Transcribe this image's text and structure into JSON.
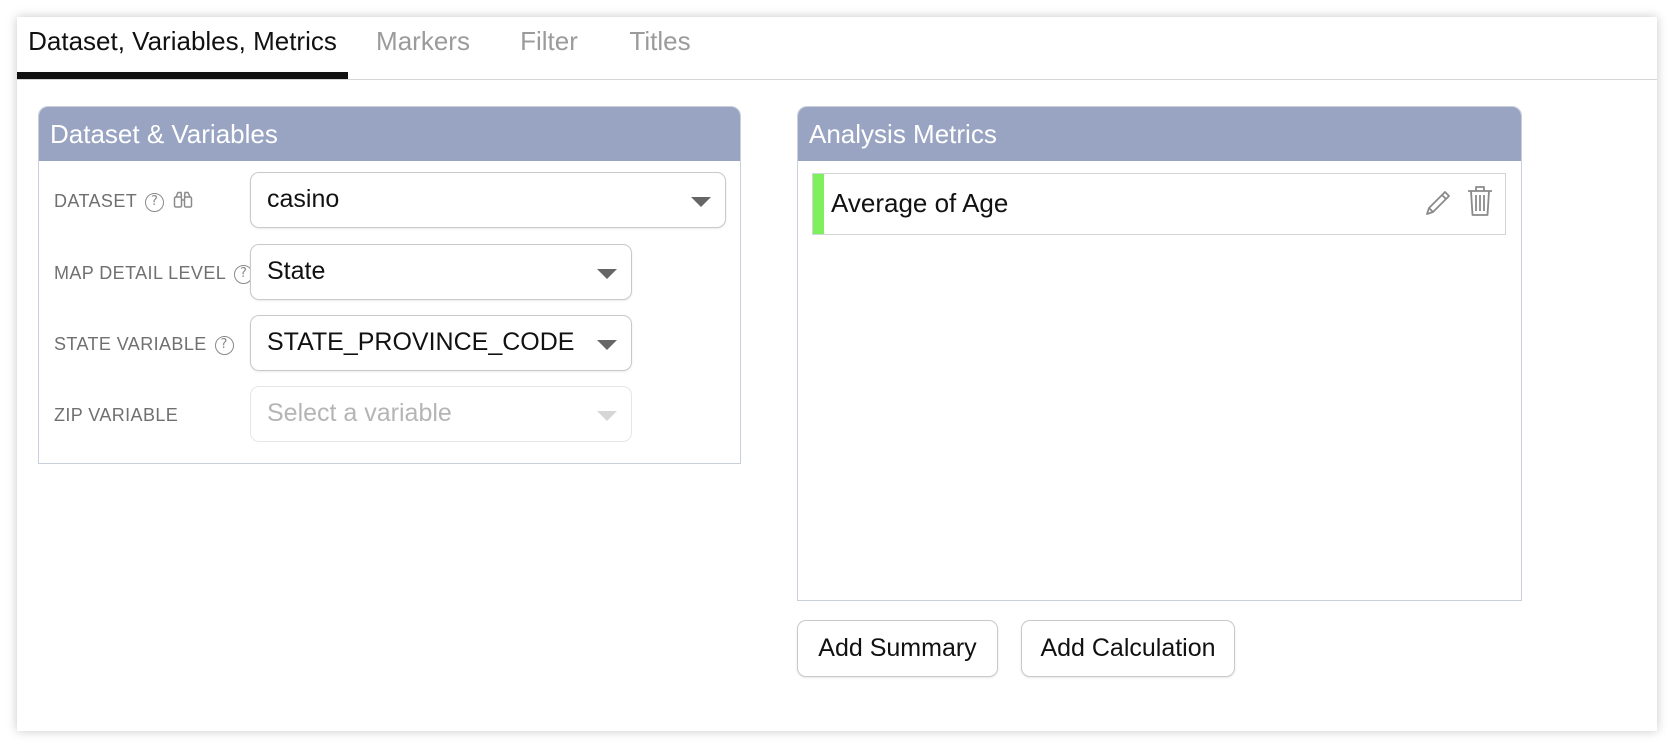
{
  "tabs": [
    {
      "label": "Dataset, Variables, Metrics",
      "active": true
    },
    {
      "label": "Markers",
      "active": false
    },
    {
      "label": "Filter",
      "active": false
    },
    {
      "label": "Titles",
      "active": false
    }
  ],
  "dataset_panel": {
    "title": "Dataset & Variables",
    "rows": [
      {
        "label": "DATASET",
        "value": "casino"
      },
      {
        "label": "MAP DETAIL LEVEL",
        "value": "State"
      },
      {
        "label": "STATE VARIABLE",
        "value": "STATE_PROVINCE_CODE"
      },
      {
        "label": "ZIP VARIABLE",
        "placeholder": "Select a variable"
      }
    ],
    "help_glyph": "?"
  },
  "metrics_panel": {
    "title": "Analysis Metrics",
    "items": [
      {
        "label": "Average of Age",
        "indicator_color": "#7ef05c"
      }
    ],
    "add_summary_label": "Add Summary",
    "add_calculation_label": "Add Calculation"
  },
  "colors": {
    "panel_header": "#98a4c2",
    "active_tab": "#111111",
    "inactive_tab": "#9b9b9b"
  },
  "icons": [
    "help-circle-icon",
    "binoculars-icon",
    "chevron-down-icon",
    "pencil-icon",
    "trash-icon"
  ]
}
